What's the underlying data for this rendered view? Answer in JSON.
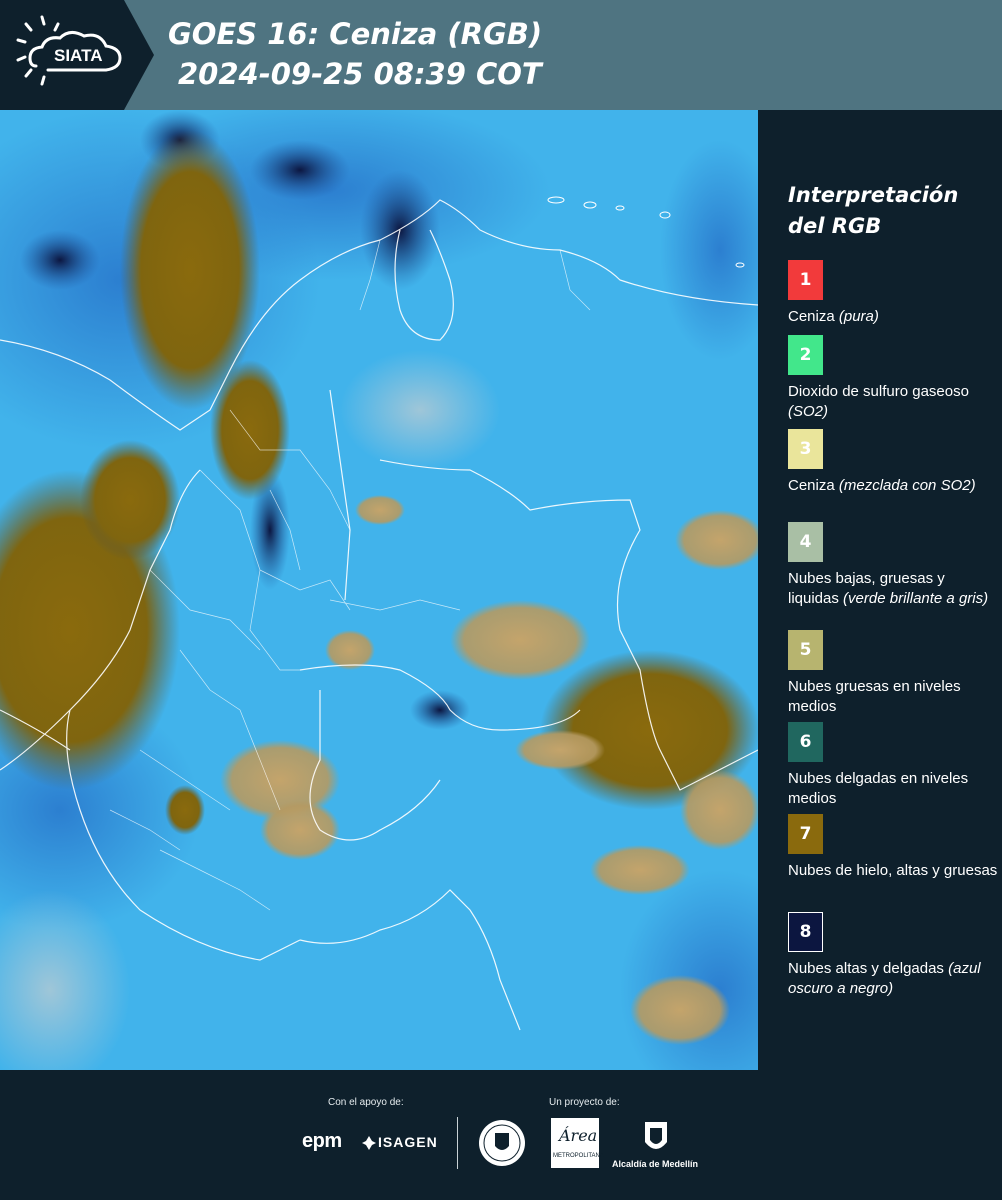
{
  "header": {
    "logo_text": "SIATA",
    "title_line1": "GOES 16: Ceniza (RGB)",
    "title_line2": "2024-09-25 08:39 COT"
  },
  "legend": {
    "title_line1": "Interpretación",
    "title_line2": "del RGB",
    "items": [
      {
        "number": "1",
        "color": "#f23a3b",
        "text": "Ceniza ",
        "note": "(pura)"
      },
      {
        "number": "2",
        "color": "#42e78b",
        "text": "Dioxido de sulfuro gaseoso ",
        "note": "(SO2)"
      },
      {
        "number": "3",
        "color": "#eae59b",
        "text": "Ceniza ",
        "note": "(mezclada con SO2)"
      },
      {
        "number": "4",
        "color": "#a9bfa5",
        "text": "Nubes bajas, gruesas y liquidas ",
        "note": "(verde brillante a gris)"
      },
      {
        "number": "5",
        "color": "#b7b46f",
        "text": "Nubes gruesas en niveles medios",
        "note": ""
      },
      {
        "number": "6",
        "color": "#20675f",
        "text": "Nubes delgadas en niveles medios",
        "note": ""
      },
      {
        "number": "7",
        "color": "#8a6a0d",
        "text": "Nubes de hielo, altas y gruesas",
        "note": ""
      },
      {
        "number": "8",
        "color": "#0c1640",
        "text": "Nubes altas y delgadas ",
        "note": "(azul oscuro a negro)"
      }
    ]
  },
  "footer": {
    "support_label": "Con el apoyo de:",
    "project_label": "Un proyecto de:",
    "logos": {
      "epm": "epm",
      "isagen": "ISAGEN",
      "area_metropolitana": "Área",
      "area_metropolitana_sub": "METROPOLITANA",
      "alcaldia": "Alcaldía de Medellín"
    }
  },
  "colors": {
    "header_bg": "#4f7481",
    "panel_bg": "#0e202c",
    "ocean_blue": "#41b3eb",
    "ice_cloud_brown": "#8a6a0d",
    "thick_cloud_tan": "#b59a62"
  }
}
